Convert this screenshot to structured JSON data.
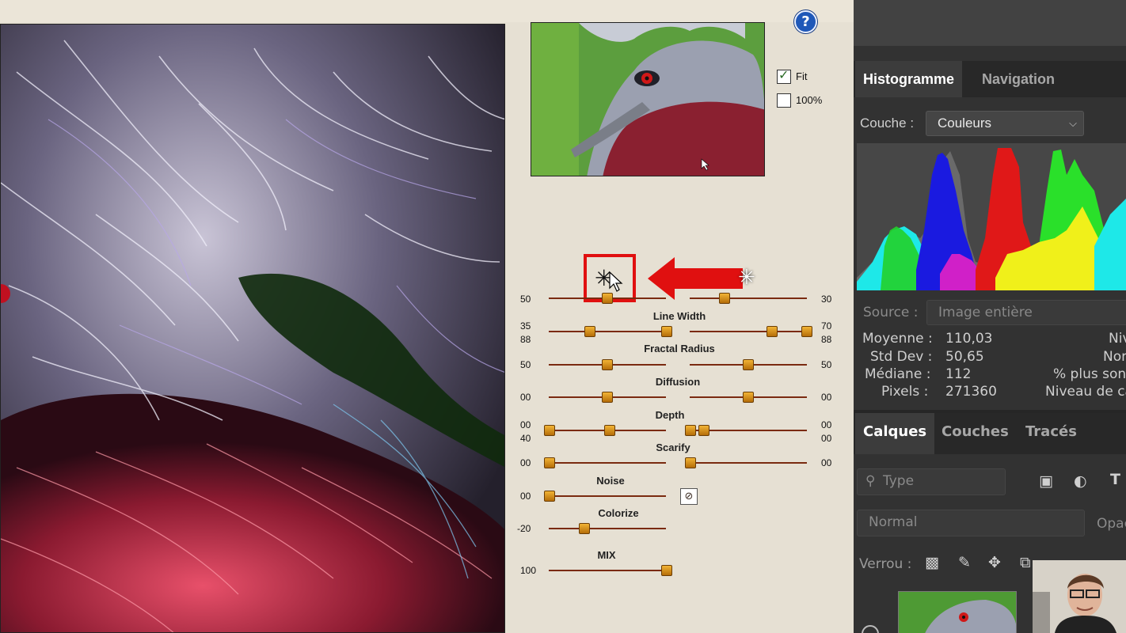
{
  "plugin": {
    "help_label": "?",
    "fit_label": "Fit",
    "fit_checked": true,
    "zoom100_label": "100%",
    "zoom100_checked": false,
    "sliders": [
      {
        "label": "",
        "left_value": "50",
        "right_value": "30",
        "left_pos": 0.5,
        "right_pos": 0.3
      },
      {
        "label": "Line Width",
        "left_value": "35",
        "left_value2": "88",
        "right_value": "70",
        "right_value2": "88",
        "left_pos": 0.35,
        "right_pos": 0.7
      },
      {
        "label": "Fractal Radius",
        "left_value": "50",
        "right_value": "50",
        "left_pos": 0.5,
        "right_pos": 0.5
      },
      {
        "label": "Diffusion",
        "left_value": "00",
        "right_value": "00",
        "left_pos": 0.5,
        "right_pos": 0.5
      },
      {
        "label": "Depth",
        "left_value": "00",
        "left_value2": "40",
        "right_value": "00",
        "right_value2": "00",
        "left_pos": 0.0,
        "right_pos": 0.0
      },
      {
        "label": "Scarify",
        "left_value": "00",
        "right_value": "00",
        "left_pos": 0.0,
        "right_pos": 0.0
      },
      {
        "label": "Noise",
        "left_value": "00",
        "left_pos": 0.0
      },
      {
        "label": "Colorize",
        "left_value": "-20",
        "left_pos": 0.3
      },
      {
        "label": "MIX",
        "left_value": "100",
        "left_pos": 1.0
      }
    ],
    "colors": {
      "highlight": "#e01010",
      "knob": "#e09a18",
      "track": "#7a2a10"
    }
  },
  "photoshop": {
    "tabs_top": [
      "Histogramme",
      "Navigation"
    ],
    "couche_label": "Couche :",
    "couche_value": "Couleurs",
    "source_label": "Source :",
    "source_value": "Image entière",
    "stats": {
      "moyenne_label": "Moyenne :",
      "moyenne": "110,03",
      "stddev_label": "Std Dev :",
      "stddev": "50,65",
      "mediane_label": "Médiane :",
      "mediane": "112",
      "pixels_label": "Pixels :",
      "pixels": "271360",
      "right1": "Niv",
      "right2": "Nor",
      "right3": "% plus son",
      "right4": "Niveau de ca"
    },
    "tabs_bottom": [
      "Calques",
      "Couches",
      "Tracés"
    ],
    "type_placeholder": "Type",
    "blend_mode": "Normal",
    "opacity_label": "Opac",
    "verrou_label": "Verrou :"
  }
}
